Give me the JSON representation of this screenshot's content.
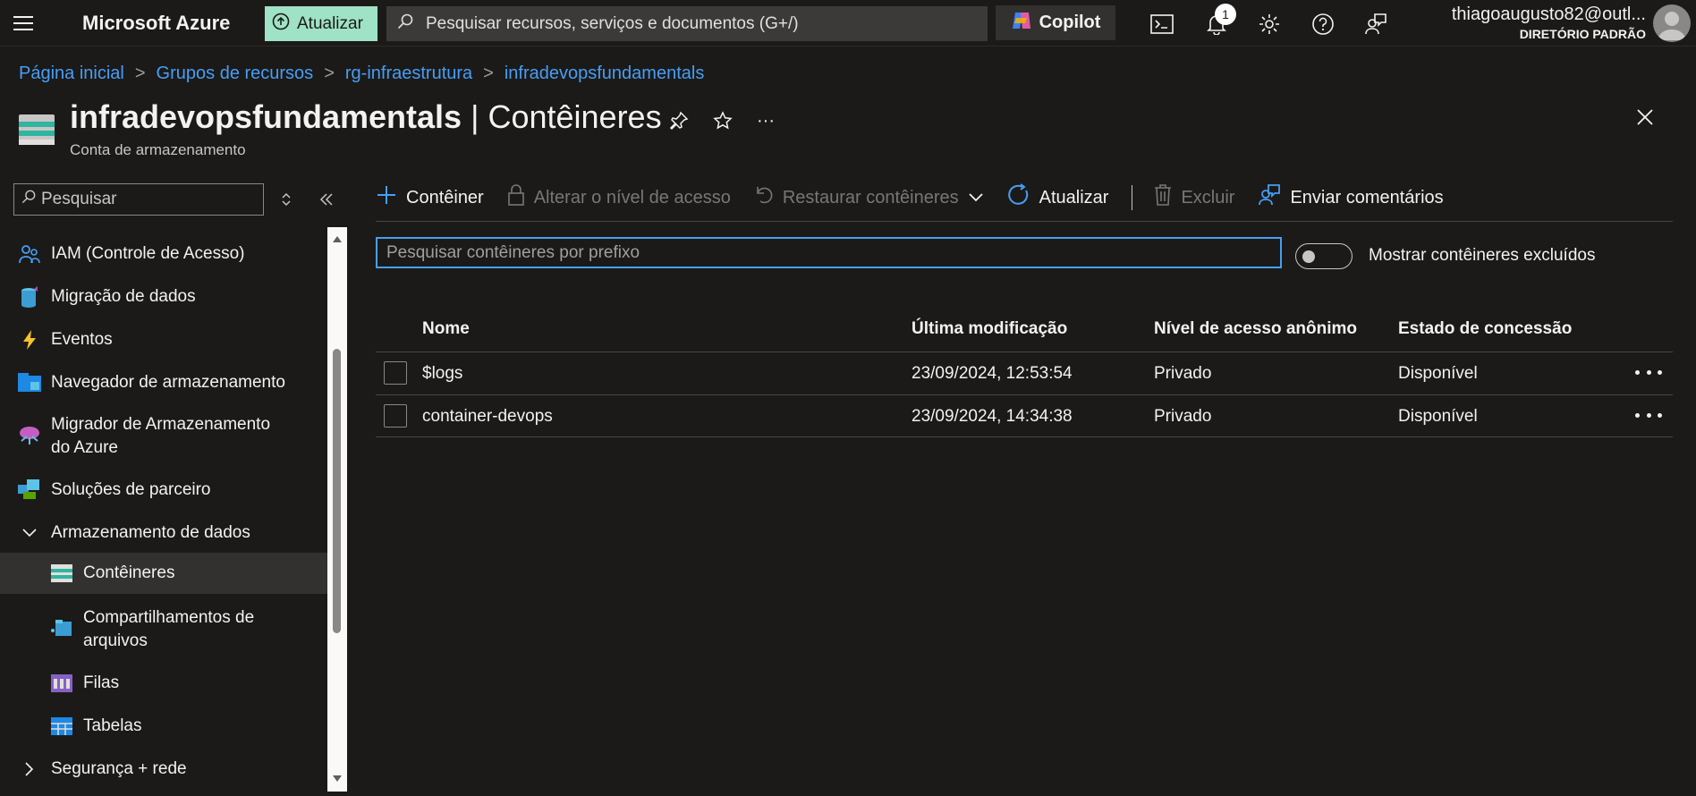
{
  "topbar": {
    "brand": "Microsoft Azure",
    "update_label": "Atualizar",
    "search_placeholder": "Pesquisar recursos, serviços e documentos (G+/)",
    "copilot_label": "Copilot",
    "notification_count": "1",
    "user_email": "thiagoaugusto82@outl...",
    "user_directory": "DIRETÓRIO PADRÃO"
  },
  "breadcrumb": {
    "items": [
      "Página inicial",
      "Grupos de recursos",
      "rg-infraestrutura",
      "infradevopsfundamentals"
    ],
    "separator": ">"
  },
  "header": {
    "resource_name": "infradevopsfundamentals",
    "page_name": "| Contêineres",
    "subtitle": "Conta de armazenamento",
    "more_label": "···"
  },
  "sidebar": {
    "search_placeholder": "Pesquisar",
    "items": [
      {
        "label": "IAM (Controle de Acesso)",
        "icon": "iam-icon"
      },
      {
        "label": "Migração de dados",
        "icon": "data-migration-icon"
      },
      {
        "label": "Eventos",
        "icon": "events-bolt-icon"
      },
      {
        "label": "Navegador de armazenamento",
        "icon": "storage-browser-icon"
      },
      {
        "label": "Migrador de Armazenamento",
        "label2": "do Azure",
        "icon": "storage-mover-icon"
      },
      {
        "label": "Soluções de parceiro",
        "icon": "partner-solutions-icon"
      },
      {
        "label": "Armazenamento de dados",
        "icon": "chevron-down-icon"
      },
      {
        "label": "Contêineres",
        "icon": "containers-icon"
      },
      {
        "label": "Compartilhamentos de",
        "label2": "arquivos",
        "icon": "file-shares-icon"
      },
      {
        "label": "Filas",
        "icon": "queues-icon"
      },
      {
        "label": "Tabelas",
        "icon": "tables-icon"
      },
      {
        "label": "Segurança + rede",
        "icon": "chevron-right-icon"
      }
    ]
  },
  "toolbar": {
    "add_container": "Contêiner",
    "change_access": "Alterar o nível de acesso",
    "restore": "Restaurar contêineres",
    "refresh": "Atualizar",
    "delete": "Excluir",
    "feedback": "Enviar comentários"
  },
  "filter": {
    "placeholder": "Pesquisar contêineres por prefixo",
    "toggle_label": "Mostrar contêineres excluídos"
  },
  "table": {
    "columns": [
      "Nome",
      "Última modificação",
      "Nível de acesso anônimo",
      "Estado de concessão"
    ],
    "rows": [
      {
        "name": "$logs",
        "modified": "23/09/2024, 12:53:54",
        "access": "Privado",
        "lease": "Disponível"
      },
      {
        "name": "container-devops",
        "modified": "23/09/2024, 14:34:38",
        "access": "Privado",
        "lease": "Disponível"
      }
    ]
  },
  "colors": {
    "accent": "#479ef5",
    "update_bg": "#9fe2c5",
    "background": "#1b1a19"
  }
}
